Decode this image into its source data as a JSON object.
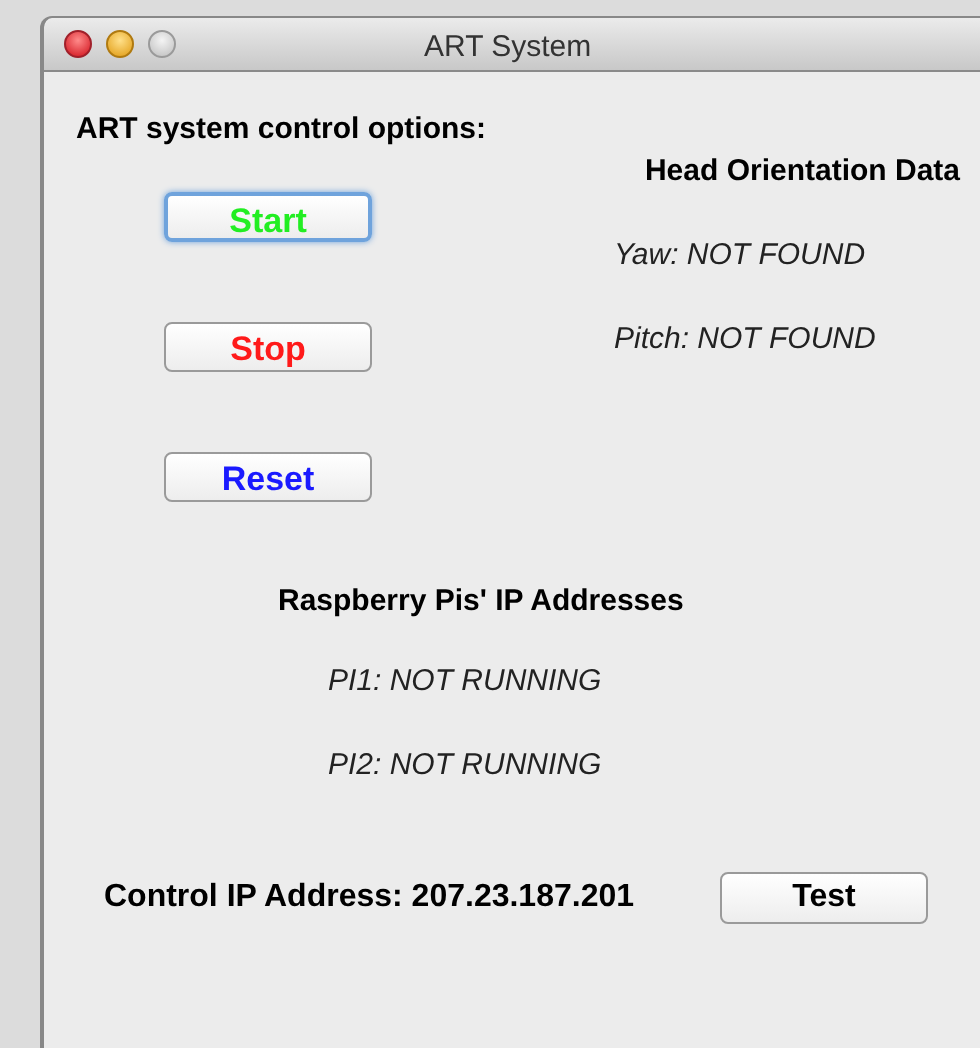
{
  "window": {
    "title": "ART System"
  },
  "options_label": "ART system control options:",
  "control_buttons": [
    {
      "label": "Start",
      "color": "#22ee22",
      "focused": true
    },
    {
      "label": "Stop",
      "color": "#ff1a1a",
      "focused": false
    },
    {
      "label": "Reset",
      "color": "#1a1aff",
      "focused": false
    }
  ],
  "head_orientation": {
    "heading": "Head Orientation Data",
    "values": [
      "Yaw: NOT FOUND",
      "Pitch: NOT FOUND"
    ]
  },
  "raspberry_pis": {
    "heading": "Raspberry Pis' IP Addresses",
    "values": [
      "PI1: NOT RUNNING",
      "PI2: NOT RUNNING"
    ]
  },
  "control_ip": {
    "label": "Control IP Address: 207.23.187.201",
    "button": "Test"
  }
}
